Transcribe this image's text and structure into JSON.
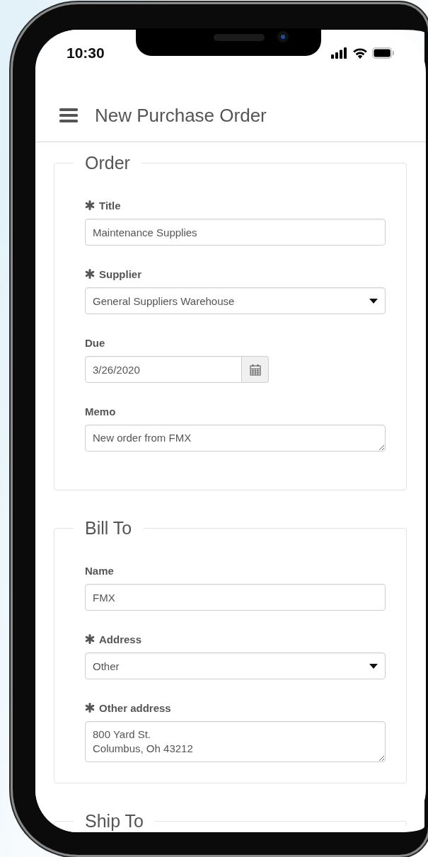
{
  "status_bar": {
    "time": "10:30"
  },
  "header": {
    "title": "New Purchase Order"
  },
  "sections": [
    {
      "legend": "Order",
      "fields": [
        {
          "kind": "text",
          "label": "Title",
          "required": true,
          "value": "Maintenance Supplies"
        },
        {
          "kind": "select",
          "label": "Supplier",
          "required": true,
          "value": "General Suppliers Warehouse"
        },
        {
          "kind": "date",
          "label": "Due",
          "required": false,
          "value": "3/26/2020"
        },
        {
          "kind": "textarea",
          "label": "Memo",
          "required": false,
          "value": "New order from FMX"
        }
      ]
    },
    {
      "legend": "Bill To",
      "fields": [
        {
          "kind": "text",
          "label": "Name",
          "required": false,
          "value": "FMX"
        },
        {
          "kind": "select",
          "label": "Address",
          "required": true,
          "value": "Other"
        },
        {
          "kind": "textarea",
          "label": "Other address",
          "required": true,
          "value": "800 Yard St.\nColumbus, Oh 43212"
        }
      ]
    },
    {
      "legend": "Ship To"
    }
  ]
}
